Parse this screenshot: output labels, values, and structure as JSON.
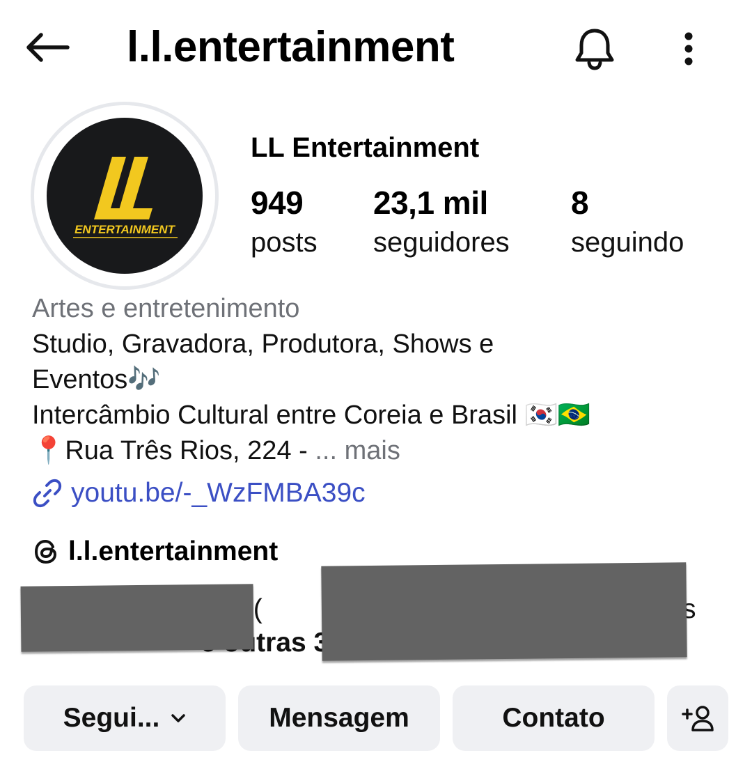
{
  "header": {
    "title": "l.l.entertainment",
    "back_icon": "arrow-left-icon",
    "bell_icon": "bell-icon",
    "more_icon": "more-vertical-icon"
  },
  "profile": {
    "display_name": "LL Entertainment",
    "avatar_logo_text": "ENTERTAINMENT",
    "avatar_logo_mark": "LL",
    "stats": [
      {
        "value": "949",
        "label": "posts"
      },
      {
        "value": "23,1 mil",
        "label": "seguidores"
      },
      {
        "value": "8",
        "label": "seguindo"
      }
    ]
  },
  "bio": {
    "category": "Artes e entretenimento",
    "line1": "Studio, Gravadora, Produtora, Shows e",
    "line2": "Eventos🎶",
    "line3": "Intercâmbio Cultural entre Coreia e Brasil 🇰🇷🇧🇷",
    "line4": "📍Rua Três Rios, 224 - ",
    "more": "... mais",
    "link": "youtu.be/-_WzFMBA39c",
    "threads_handle": "l.l.entertainment"
  },
  "followed_by": {
    "fragment1": "uido(",
    "fragment2": "e outras 3",
    "fragment3": "s"
  },
  "actions": {
    "following": "Segui...",
    "message": "Mensagem",
    "contact": "Contato"
  },
  "colors": {
    "link": "#3b4fc4",
    "muted": "#6e7177",
    "button_bg": "#eff0f3",
    "logo_yellow": "#f2c81f",
    "avatar_bg": "#18191b"
  }
}
